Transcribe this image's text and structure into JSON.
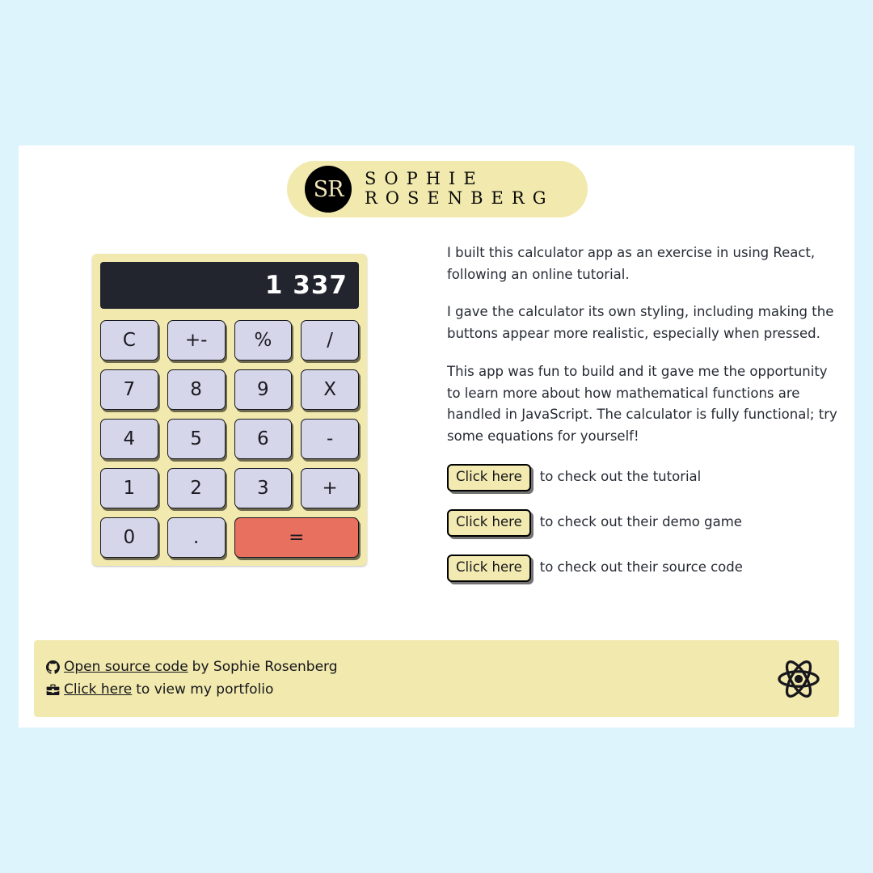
{
  "colors": {
    "page_background": "#ddf4fc",
    "card_background": "#ffffff",
    "accent_yellow": "#f1e9ad",
    "button_yellow": "#f2eab0",
    "key_lavender": "#d6d6ea",
    "equals_salmon": "#e8705f",
    "display_dark": "#22242e",
    "text_dark": "#262a33"
  },
  "header": {
    "monogram": "SR",
    "name_line1": "SOPHIE",
    "name_line2": "ROSENBERG",
    "logo_icon": "sr-monogram-icon"
  },
  "calculator": {
    "display_value": "1 337",
    "keys": [
      {
        "label": "C",
        "kind": "clear"
      },
      {
        "label": "+-",
        "kind": "sign"
      },
      {
        "label": "%",
        "kind": "percent"
      },
      {
        "label": "/",
        "kind": "divide"
      },
      {
        "label": "7",
        "kind": "digit"
      },
      {
        "label": "8",
        "kind": "digit"
      },
      {
        "label": "9",
        "kind": "digit"
      },
      {
        "label": "X",
        "kind": "multiply"
      },
      {
        "label": "4",
        "kind": "digit"
      },
      {
        "label": "5",
        "kind": "digit"
      },
      {
        "label": "6",
        "kind": "digit"
      },
      {
        "label": "-",
        "kind": "minus"
      },
      {
        "label": "1",
        "kind": "digit"
      },
      {
        "label": "2",
        "kind": "digit"
      },
      {
        "label": "3",
        "kind": "digit"
      },
      {
        "label": "+",
        "kind": "plus"
      },
      {
        "label": "0",
        "kind": "digit"
      },
      {
        "label": ".",
        "kind": "decimal"
      },
      {
        "label": "=",
        "kind": "equals"
      }
    ]
  },
  "description": {
    "paragraph1": "I built this calculator app as an exercise in using React, following an online tutorial.",
    "paragraph2": "I gave the calculator its own styling, including making the buttons appear more realistic, especially when pressed.",
    "paragraph3": "This app was fun to build and it gave me the opportunity to learn more about how mathematical functions are handled in JavaScript. The calculator is fully functional; try some equations for yourself!"
  },
  "link_rows": [
    {
      "button_label": "Click here",
      "text": "to check out the tutorial"
    },
    {
      "button_label": "Click here",
      "text": "to check out their demo game"
    },
    {
      "button_label": "Click here",
      "text": "to check out their source code"
    }
  ],
  "footer": {
    "line1": {
      "icon": "github-icon",
      "link": "Open source code",
      "text": "by Sophie Rosenberg"
    },
    "line2": {
      "icon": "briefcase-icon",
      "link": "Click here",
      "text": "to view my portfolio"
    },
    "brand_icon": "react-logo-icon"
  }
}
